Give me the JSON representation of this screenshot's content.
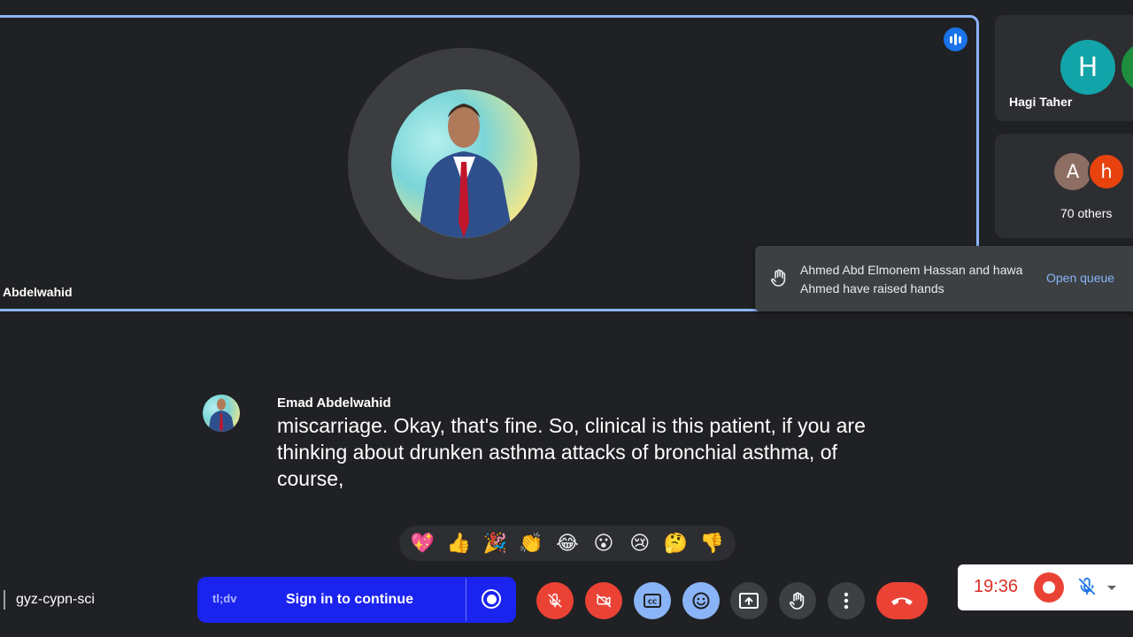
{
  "main_tile": {
    "name": "Abdelwahid",
    "speaking": true
  },
  "side_tiles": [
    {
      "name": "Hagi Taher",
      "avatars": [
        {
          "letter": "H",
          "color": "#12a4a8"
        },
        {
          "letter": "",
          "color": "#1e8e3e"
        }
      ]
    },
    {
      "name": "70 others",
      "avatars": [
        {
          "letter": "A",
          "color": "#8d6e63"
        },
        {
          "letter": "h",
          "color": "#e8430e"
        }
      ]
    }
  ],
  "toast": {
    "message": "Ahmed Abd Elmonem Hassan and hawa Ahmed have raised hands",
    "action": "Open queue",
    "icon": "raised-hand-icon"
  },
  "captions": {
    "speaker": "Emad Abdelwahid",
    "text": "miscarriage. Okay, that's fine. So, clinical is this patient, if you are thinking about drunken asthma attacks of bronchial asthma, of course,"
  },
  "reactions": [
    {
      "name": "sparkling-heart",
      "glyph": "💖"
    },
    {
      "name": "thumbs-up",
      "glyph": "👍"
    },
    {
      "name": "party-popper",
      "glyph": "🎉"
    },
    {
      "name": "clapping-hands",
      "glyph": "👏"
    },
    {
      "name": "tears-of-joy",
      "glyph": "😂"
    },
    {
      "name": "surprised",
      "glyph": "😮"
    },
    {
      "name": "crying",
      "glyph": "😢"
    },
    {
      "name": "thinking",
      "glyph": "🤔"
    },
    {
      "name": "thumbs-down",
      "glyph": "👎"
    }
  ],
  "meeting_code": "gyz-cypn-sci",
  "tldv": {
    "logo": "tl;dv",
    "signin": "Sign in to continue"
  },
  "controls": [
    {
      "name": "mic-off-button",
      "icon": "mic-off-icon",
      "style": "red"
    },
    {
      "name": "camera-off-button",
      "icon": "camera-off-icon",
      "style": "red"
    },
    {
      "name": "captions-button",
      "icon": "captions-icon",
      "style": "blue"
    },
    {
      "name": "emoji-button",
      "icon": "emoji-icon",
      "style": "blue"
    },
    {
      "name": "present-button",
      "icon": "present-icon",
      "style": "grey"
    },
    {
      "name": "raise-hand-button",
      "icon": "hand-icon",
      "style": "grey"
    },
    {
      "name": "more-options-button",
      "icon": "more-vert-icon",
      "style": "grey"
    },
    {
      "name": "leave-call-button",
      "icon": "phone-hangup-icon",
      "style": "end"
    }
  ],
  "recording": {
    "time": "19:36"
  },
  "colors": {
    "accent": "#8ab4f8",
    "danger": "#ea4335",
    "tldv_blue": "#1b23ef",
    "background": "#202124"
  }
}
